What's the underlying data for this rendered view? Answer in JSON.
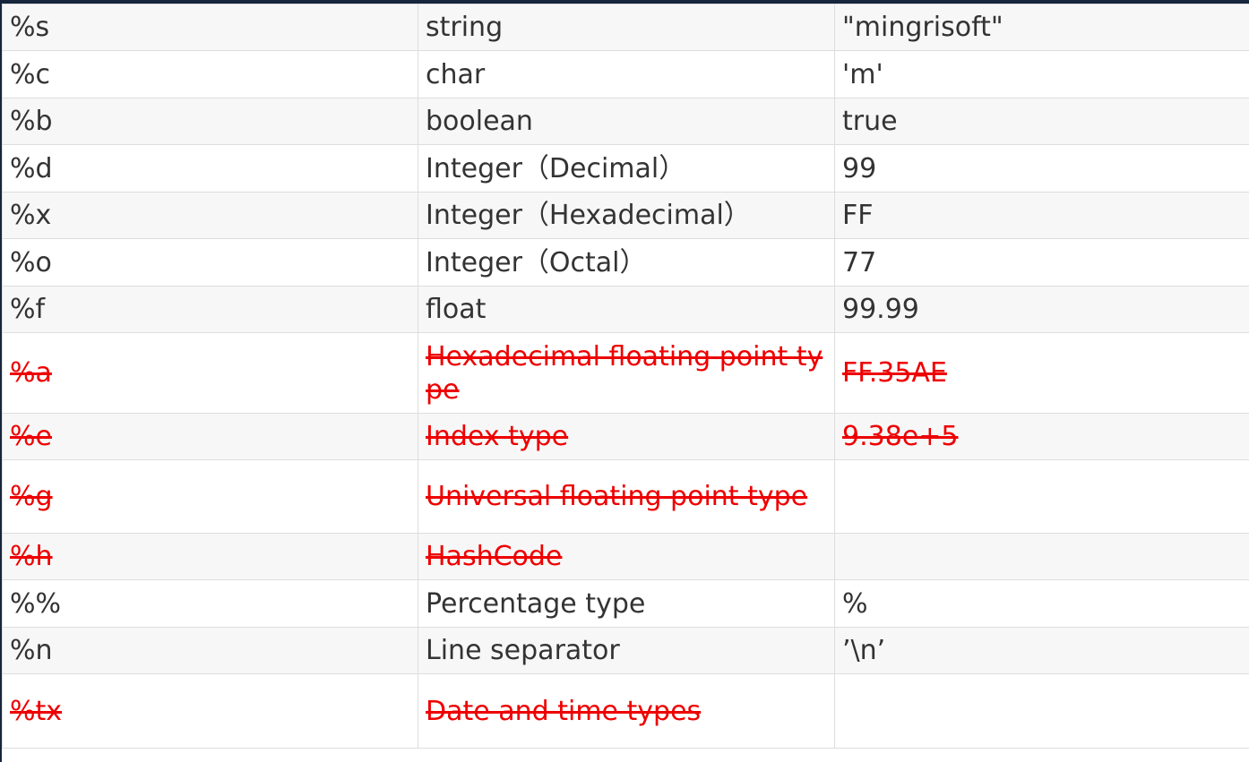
{
  "rows": [
    {
      "spec": "%s",
      "type": "string",
      "example": "\"mingrisoft\"",
      "deprecated": false
    },
    {
      "spec": "%c",
      "type": "char",
      "example": "'m'",
      "deprecated": false
    },
    {
      "spec": "%b",
      "type": "boolean",
      "example": "true",
      "deprecated": false
    },
    {
      "spec": "%d",
      "type": "Integer（Decimal）",
      "example": "99",
      "deprecated": false
    },
    {
      "spec": "%x",
      "type": "Integer（Hexadecimal）",
      "example": "FF",
      "deprecated": false
    },
    {
      "spec": "%o",
      "type": "Integer（Octal）",
      "example": "77",
      "deprecated": false
    },
    {
      "spec": "%f",
      "type": "float",
      "example": "99.99",
      "deprecated": false
    },
    {
      "spec": "%a",
      "type": "Hexadecimal floating point type",
      "example": "FF.35AE",
      "deprecated": true
    },
    {
      "spec": "%e",
      "type": "Index type",
      "example": "9.38e+5",
      "deprecated": true
    },
    {
      "spec": "%g",
      "type": "Universal floating point type",
      "example": "",
      "deprecated": true
    },
    {
      "spec": "%h",
      "type": "HashCode",
      "example": "",
      "deprecated": true
    },
    {
      "spec": "%%",
      "type": "Percentage type",
      "example": "%",
      "deprecated": false
    },
    {
      "spec": "%n",
      "type": "Line separator",
      "example": "’\\n’",
      "deprecated": false
    },
    {
      "spec": "%tx",
      "type": "Date and time types",
      "example": "",
      "deprecated": true
    }
  ],
  "colors": {
    "deprecated_text": "#ee0000",
    "normal_text": "#333333",
    "stripe": "#f7f7f7",
    "border": "#dddddd",
    "frame": "#17263d"
  }
}
